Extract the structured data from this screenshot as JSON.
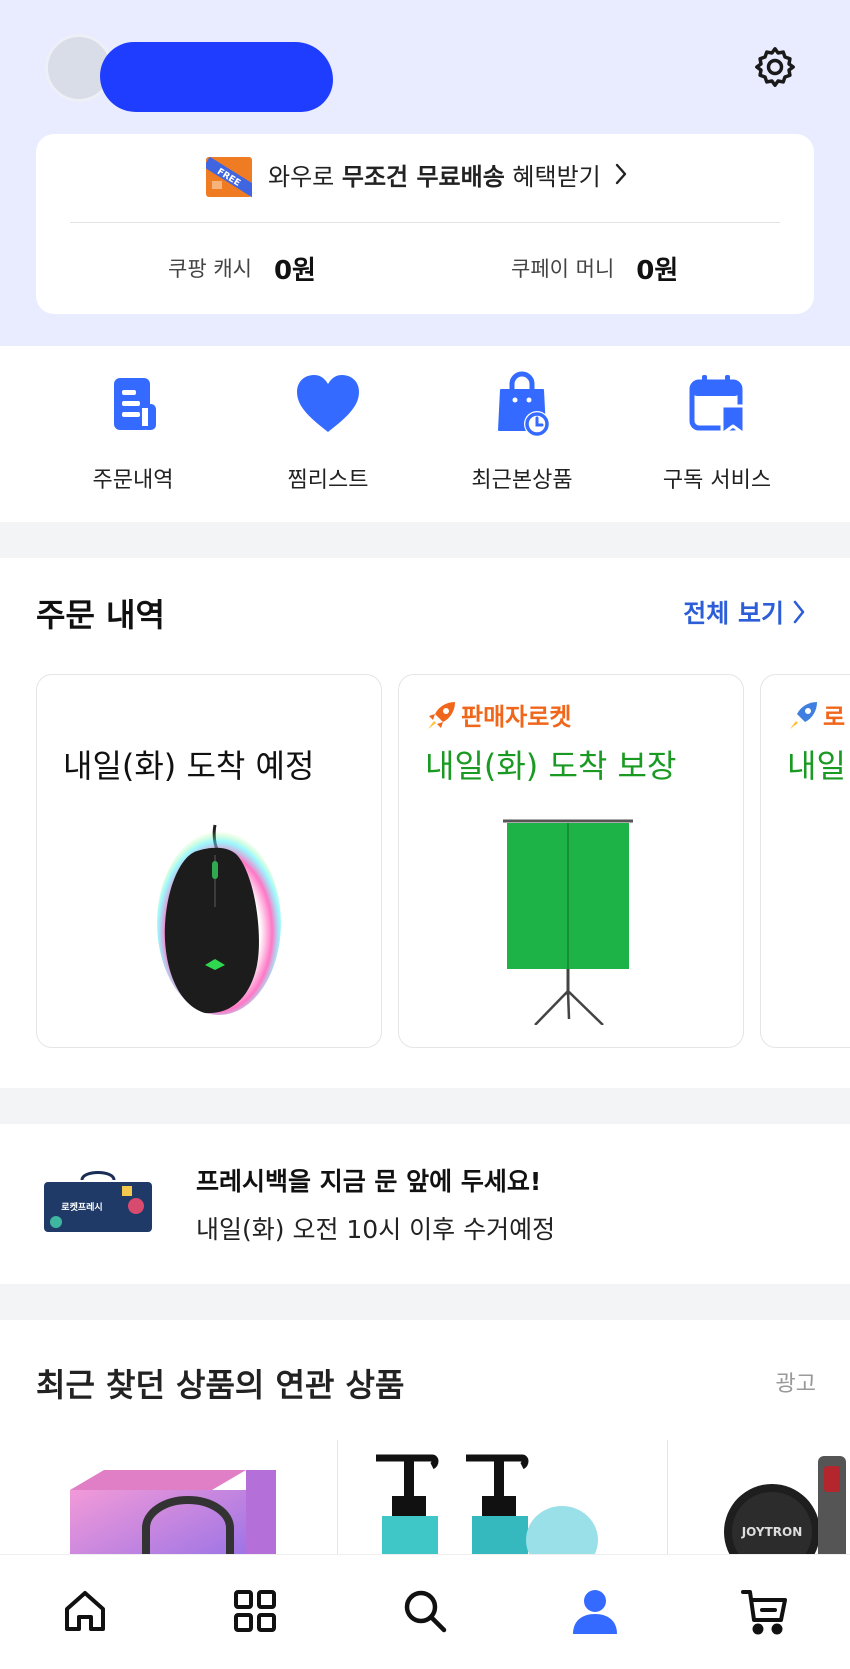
{
  "header": {
    "benefit": {
      "badge": "FREE",
      "prefix": "와우로 ",
      "bold": "무조건 무료배송",
      "suffix": " 혜택받기"
    },
    "wallets": [
      {
        "label": "쿠팡 캐시",
        "value": "0원"
      },
      {
        "label": "쿠페이 머니",
        "value": "0원"
      }
    ]
  },
  "quick_menu": [
    {
      "label": "주문내역",
      "icon": "receipt-icon"
    },
    {
      "label": "찜리스트",
      "icon": "heart-icon"
    },
    {
      "label": "최근본상품",
      "icon": "shopping-bag-clock-icon"
    },
    {
      "label": "구독 서비스",
      "icon": "calendar-bookmark-icon"
    }
  ],
  "orders": {
    "title": "주문 내역",
    "see_all": "전체 보기",
    "cards": [
      {
        "badge": "",
        "status": "내일(화) 도착 예정",
        "status_color": "#111111",
        "product": "gaming-mouse"
      },
      {
        "badge": "판매자로켓",
        "status": "내일(화) 도착 보장",
        "status_color": "#1a9a22",
        "product": "green-screen"
      },
      {
        "badge": "로",
        "status": "내일",
        "status_color": "#1a9a22",
        "product": ""
      }
    ]
  },
  "fresh_bag": {
    "bag_label": "로켓프레시",
    "title": "프레시백을 지금 문 앞에 두세요!",
    "subtitle": "내일(화) 오전 10시 이후 수거예정"
  },
  "related": {
    "title": "최근 찾던 상품의 연관 상품",
    "ad_label": "광고",
    "logo_text": "JOYTRON"
  },
  "bottom_nav": [
    {
      "name": "home",
      "icon": "home-icon",
      "active": false
    },
    {
      "name": "categories",
      "icon": "grid-icon",
      "active": false
    },
    {
      "name": "search",
      "icon": "search-icon",
      "active": false
    },
    {
      "name": "my-page",
      "icon": "user-icon",
      "active": true
    },
    {
      "name": "cart",
      "icon": "cart-icon",
      "active": false
    }
  ],
  "colors": {
    "header_bg": "#e9ebff",
    "accent_blue": "#346aff",
    "link_blue": "#2d5ed8",
    "green": "#1a9a22",
    "orange": "#f0661a"
  }
}
